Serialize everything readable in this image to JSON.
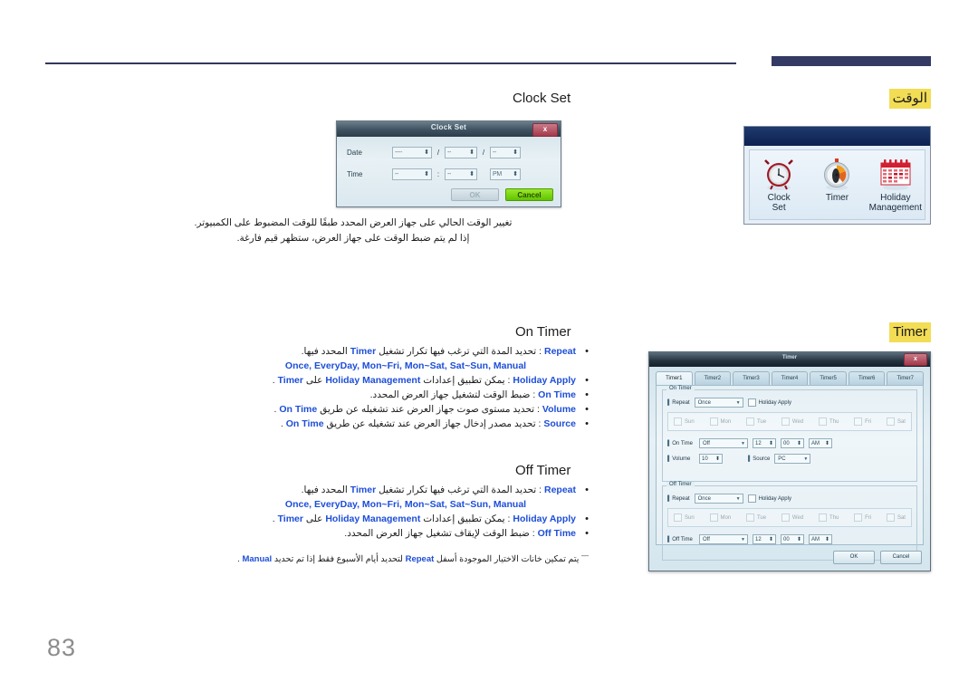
{
  "page": {
    "number": "83"
  },
  "header": {
    "accent_color": "#333a63"
  },
  "sections": {
    "clock_label": "الوقت",
    "timer_label": "Timer",
    "clock_set_heading": "Clock Set",
    "on_timer_heading": "On Timer",
    "off_timer_heading": "Off Timer"
  },
  "clock_set_dialog": {
    "title": "Clock Set",
    "close": "x",
    "date_label": "Date",
    "time_label": "Time",
    "date_values": [
      "----",
      "--",
      "--"
    ],
    "time_values": [
      "--",
      "--"
    ],
    "meridiem": "PM",
    "date_sep": "/",
    "time_sep": ":",
    "ok_label": "OK",
    "cancel_label": "Cancel"
  },
  "icon_panel": {
    "items": [
      {
        "icon": "alarm-clock-icon",
        "line1": "Clock",
        "line2": "Set"
      },
      {
        "icon": "stopwatch-timer-icon",
        "line1": "Timer",
        "line2": ""
      },
      {
        "icon": "calendar-icon",
        "line1": "Holiday",
        "line2": "Management"
      }
    ]
  },
  "intro": {
    "line1": "تغيير الوقت الحالي على جهاز العرض المحدد طبقًا للوقت المضبوط على الكمبيوتر.",
    "line2": "إذا لم يتم ضبط الوقت على جهاز العرض، ستظهر قيم فارغة."
  },
  "on_timer_bullets": [
    {
      "kw": "Repeat",
      "text": "تحديد المدة التي ترغب فيها تكرار تشغيل",
      "kw2": "Timer",
      "text2": "المحدد فيها.",
      "sub": "Once, EveryDay, Mon~Fri, Mon~Sat, Sat~Sun, Manual"
    },
    {
      "kw": "Holiday Apply",
      "text": "يمكن تطبيق إعدادات",
      "kw2": "Holiday Management",
      "text2": "على",
      "kw3": "Timer",
      "text3": "."
    },
    {
      "kw": "On Time",
      "text": "ضبط الوقت لتشغيل جهاز العرض المحدد."
    },
    {
      "kw": "Volume",
      "text": "تحديد مستوى صوت جهاز العرض عند تشغيله عن طريق",
      "kw2": "On Time",
      "text2": "."
    },
    {
      "kw": "Source",
      "text": "تحديد مصدر إدخال جهاز العرض عند تشغيله عن طريق",
      "kw2": "On Time",
      "text2": "."
    }
  ],
  "off_timer_bullets": [
    {
      "kw": "Repeat",
      "text": "تحديد المدة التي ترغب فيها تكرار تشغيل",
      "kw2": "Timer",
      "text2": "المحدد فيها.",
      "sub": "Once, EveryDay, Mon~Fri, Mon~Sat, Sat~Sun, Manual"
    },
    {
      "kw": "Holiday Apply",
      "text": "يمكن تطبيق إعدادات",
      "kw2": "Holiday Management",
      "text2": "على",
      "kw3": "Timer",
      "text3": "."
    },
    {
      "kw": "Off Time",
      "text": "ضبط الوقت لإيقاف تشغيل جهاز العرض المحدد."
    }
  ],
  "footnote": {
    "marker": "―",
    "text_a": "يتم تمكين خانات الاختيار الموجودة أسفل",
    "kw_a": "Repeat",
    "text_b": "لتحديد أيام الأسبوع فقط إذا تم تحديد",
    "kw_b": "Manual",
    "text_c": "."
  },
  "timer_dialog": {
    "title": "Timer",
    "close": "x",
    "tabs": [
      "Timer1",
      "Timer2",
      "Timer3",
      "Timer4",
      "Timer5",
      "Timer6",
      "Timer7"
    ],
    "active_tab": "Timer1",
    "on_timer": {
      "group_title": "On Timer",
      "repeat_label": "Repeat",
      "repeat_value": "Once",
      "holiday_apply_label": "Holiday Apply",
      "days": [
        "Sun",
        "Mon",
        "Tue",
        "Wed",
        "Thu",
        "Fri",
        "Sat"
      ],
      "on_time_label": "On Time",
      "on_time_state": "Off",
      "hour": "12",
      "minute": "00",
      "meridiem": "AM",
      "volume_label": "Volume",
      "volume_value": "10",
      "source_label": "Source",
      "source_value": "PC"
    },
    "off_timer": {
      "group_title": "Off Timer",
      "repeat_label": "Repeat",
      "repeat_value": "Once",
      "holiday_apply_label": "Holiday Apply",
      "days": [
        "Sun",
        "Mon",
        "Tue",
        "Wed",
        "Thu",
        "Fri",
        "Sat"
      ],
      "off_time_label": "Off Time",
      "off_time_state": "Off",
      "hour": "12",
      "minute": "00",
      "meridiem": "AM"
    },
    "ok_label": "OK",
    "cancel_label": "Cancel"
  }
}
